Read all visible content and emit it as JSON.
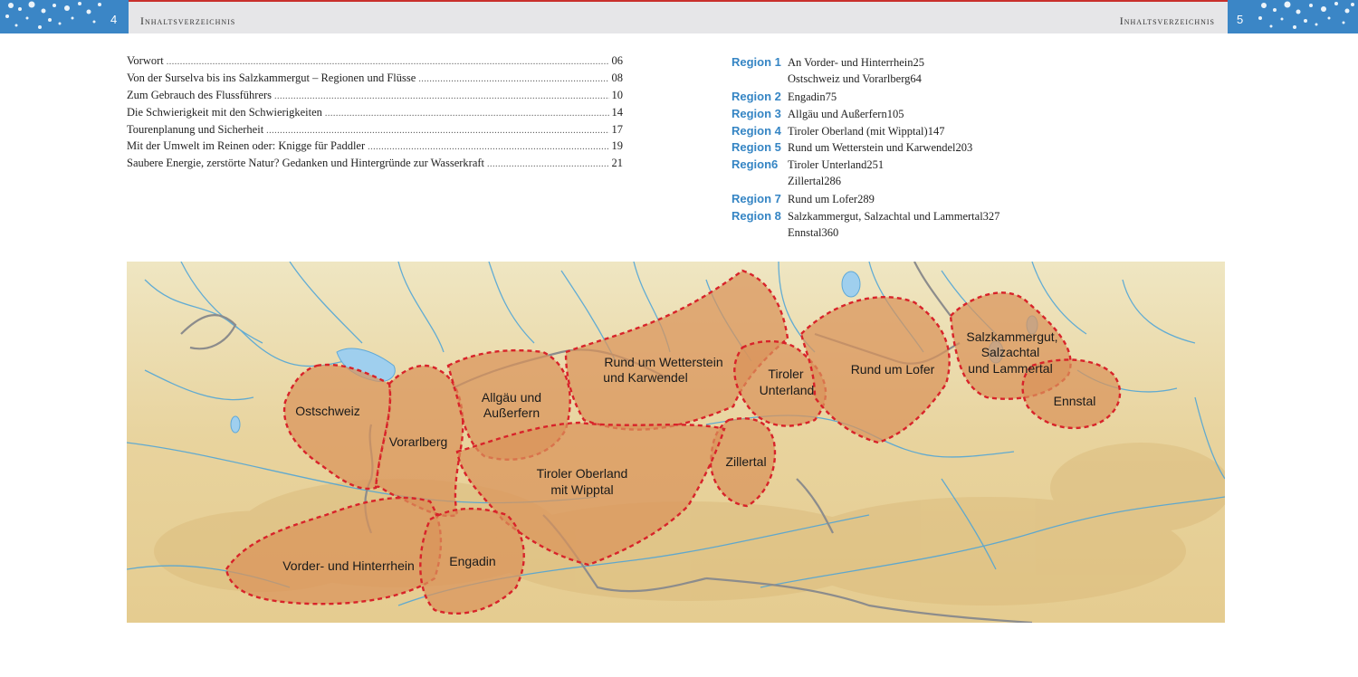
{
  "header": {
    "left_page_number": "4",
    "right_page_number": "5",
    "left_title": "Inhaltsverzeichnis",
    "right_title": "Inhaltsverzeichnis"
  },
  "toc_left": [
    {
      "title": "Vorwort",
      "page": "06"
    },
    {
      "title": "Von der Surselva bis ins Salzkammergut – Regionen und Flüsse",
      "page": "08"
    },
    {
      "title": "Zum Gebrauch des Flussführers",
      "page": "10"
    },
    {
      "title": "Die Schwierigkeit mit den Schwierigkeiten",
      "page": "14"
    },
    {
      "title": "Tourenplanung und Sicherheit",
      "page": "17"
    },
    {
      "title": "Mit der Umwelt im Reinen oder: Knigge für Paddler",
      "page": "19"
    },
    {
      "title": "Saubere Energie, zerstörte Natur? Gedanken und Hintergründe zur Wasserkraft",
      "page": "21"
    }
  ],
  "toc_right": [
    {
      "region": "Region 1",
      "title": "An Vorder- und Hinterrhein",
      "page": "25"
    },
    {
      "region": "",
      "title": "Ostschweiz und Vorarlberg",
      "page": "64"
    },
    {
      "region": "Region 2",
      "title": "Engadin",
      "page": "75"
    },
    {
      "region": "Region 3",
      "title": "Allgäu und Außerfern",
      "page": "105"
    },
    {
      "region": "Region 4",
      "title": "Tiroler Oberland (mit Wipptal)",
      "page": "147"
    },
    {
      "region": "Region 5",
      "title": "Rund um Wetterstein und Karwendel",
      "page": "203"
    },
    {
      "region": "Region6",
      "title": "Tiroler Unterland",
      "page": "251"
    },
    {
      "region": "",
      "title": "Zillertal",
      "page": "286"
    },
    {
      "region": "Region 7",
      "title": "Rund um Lofer",
      "page": "289"
    },
    {
      "region": "Region 8",
      "title": "Salzkammergut, Salzachtal und Lammertal",
      "page": "327"
    },
    {
      "region": "",
      "title": "Ennstal",
      "page": "360"
    }
  ],
  "map": {
    "labels": {
      "ostschweiz": "Ostschweiz",
      "vorarlberg": "Vorarlberg",
      "allgaeu_1": "Allgäu und",
      "allgaeu_2": "Außerfern",
      "wetterstein_1": "Rund um Wetterstein",
      "wetterstein_2": "und Karwendel",
      "tiroler_unterland_1": "Tiroler",
      "tiroler_unterland_2": "Unterland",
      "lofer": "Rund um Lofer",
      "salzkammergut_1": "Salzkammergut,",
      "salzkammergut_2": "Salzachtal",
      "salzkammergut_3": "und Lammertal",
      "ennstal": "Ennstal",
      "zillertal": "Zillertal",
      "tiroler_oberland_1": "Tiroler Oberland",
      "tiroler_oberland_2": "mit Wipptal",
      "vorder_hinterrhein": "Vorder- und Hinterrhein",
      "engadin": "Engadin"
    },
    "colors": {
      "region_fill": "#d9935a",
      "region_border": "#d8232a",
      "river": "#4aa3d8",
      "lake": "#9fcfee",
      "terrain": "#ead9a6",
      "border": "#8c8c8c"
    }
  },
  "colors": {
    "accent_blue": "#3585c4",
    "header_red": "#c9302c"
  }
}
